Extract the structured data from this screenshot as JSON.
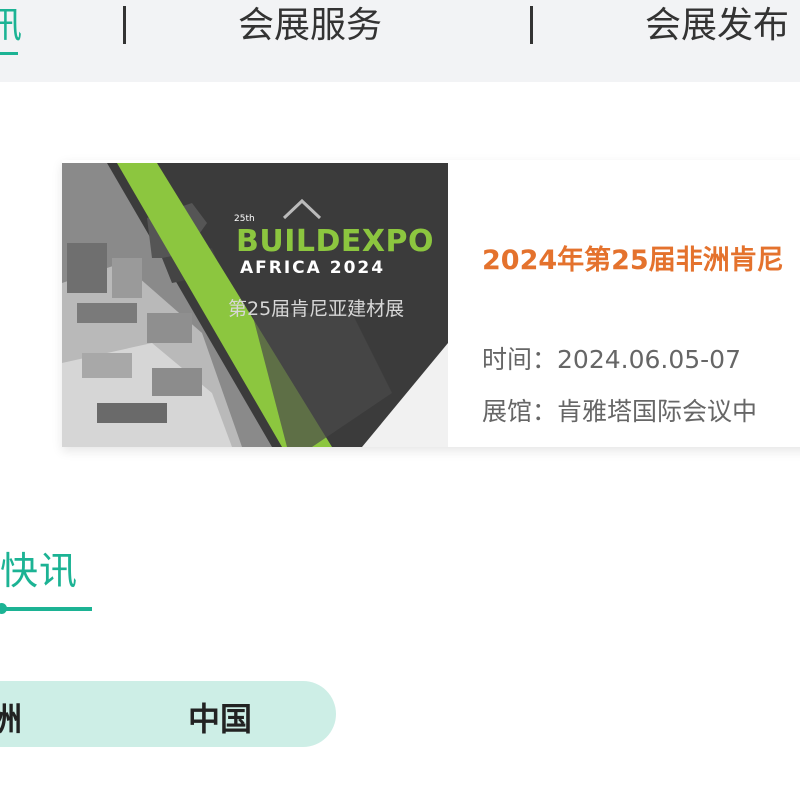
{
  "nav": {
    "items": [
      {
        "label": "讯",
        "active": true
      },
      {
        "label": "会展服务",
        "active": false
      },
      {
        "label": "会展发布",
        "active": false
      }
    ],
    "accent": "#1cb394"
  },
  "expo_card": {
    "banner": {
      "edition": "25th",
      "brand": "BUILDEXPO",
      "sub_brand": "AFRICA 2024",
      "chinese_caption": "第25届肯尼亚建材展"
    },
    "title": "2024年第25届非洲肯尼",
    "time_label": "时间：",
    "time_value": "2024.06.05-07",
    "hall_label": "展馆：",
    "hall_value": "肯雅塔国际会议中",
    "title_color": "#e4722d"
  },
  "section": {
    "title": "快讯"
  },
  "region_tabs": [
    {
      "label": "洲"
    },
    {
      "label": "中国"
    }
  ],
  "colors": {
    "nav_bg": "#f2f3f5",
    "tab_bg": "#cdeee6",
    "banner_green": "#8cc63f"
  }
}
